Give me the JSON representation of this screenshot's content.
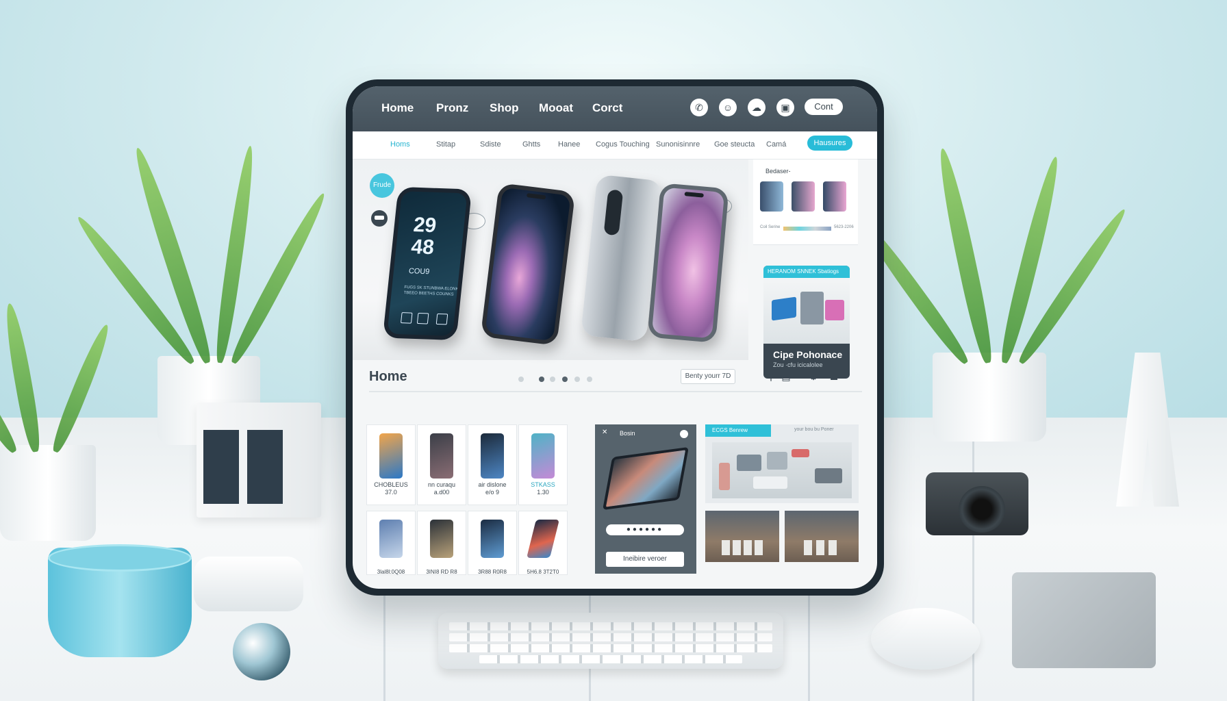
{
  "topnav": {
    "items": [
      "Home",
      "Pronz",
      "Shop",
      "Mooat",
      "Corct"
    ],
    "icons": [
      "phone-icon",
      "user-icon",
      "chat-icon",
      "cart-icon"
    ],
    "button": "Cont"
  },
  "subnav": {
    "items": [
      "Homs",
      "Stitap",
      "Sdiste",
      "Ghtts",
      "Hanee",
      "Cogus Touching",
      "Sunonisinnre",
      "Goe steucta",
      "Camá"
    ],
    "button": "Hausures"
  },
  "hero": {
    "badge": "Frude",
    "phone_time_top": "29",
    "phone_time_bottom": "48",
    "phone_small": "CDU",
    "phone_caption": "COU9",
    "phone_tiny": "FUGS SK STUNBWA ELONK TBEEO BEETHS COUNKS"
  },
  "side_panel1": {
    "title": "Bedaser-",
    "foot_left": "Coil Serine",
    "foot_right": "5623-2206"
  },
  "side_panel2": {
    "tag": "HERANOM SNNEK Sbatiogs",
    "title": "Cipe Pohonace",
    "subtitle": "Zou ·cfu icicalolee"
  },
  "section": {
    "title": "Home",
    "sort": "Benty yourr 7D",
    "tools": [
      "filter-icon",
      "grid-icon",
      "settings-icon",
      "user-icon"
    ]
  },
  "products_row1": [
    {
      "name": "CHOBLEUS",
      "price": "37.0"
    },
    {
      "name": "nn curaqu",
      "price": "a.d00"
    },
    {
      "name": "air dislone",
      "price": "e/o 9"
    },
    {
      "name": "STKASS",
      "price": "1.30"
    }
  ],
  "products_row2": [
    {
      "name": "3lal8l:0Q08"
    },
    {
      "name": "3INI8 RD R8"
    },
    {
      "name": "3R88 R0R8"
    },
    {
      "name": "5H6.8 3T2T0"
    }
  ],
  "mid_panel": {
    "header": "Bosin",
    "password": "●●●●●●",
    "button": "Ineibire veroer"
  },
  "right_panel": {
    "tag": "ECGS Benrew",
    "text": "your bou bu Poner"
  },
  "colors": {
    "accent": "#28bcd8",
    "topbar": "#4b5963",
    "panel": "#56636c"
  }
}
